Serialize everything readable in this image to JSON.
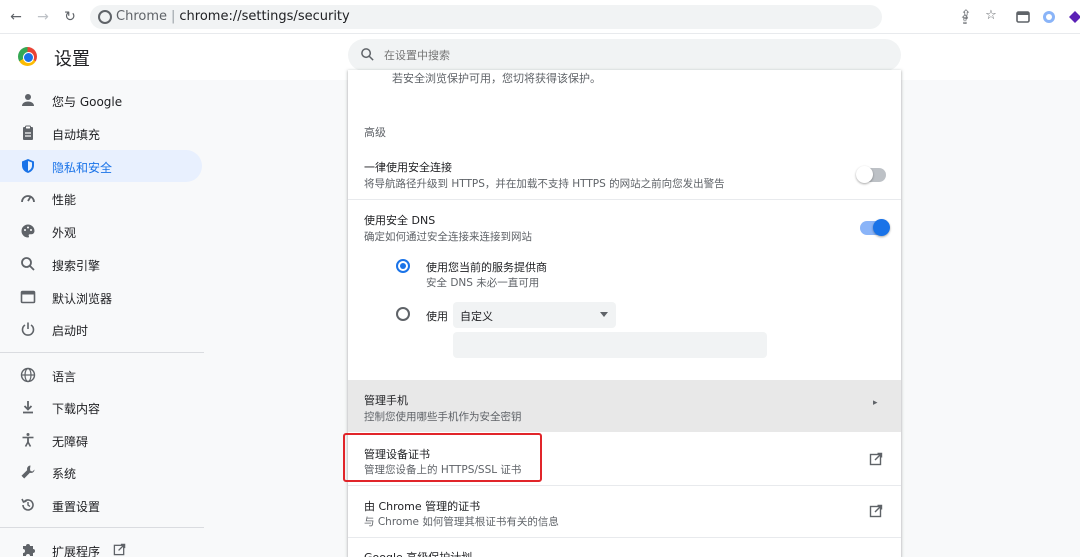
{
  "browser": {
    "omnibox_site": "Chrome",
    "omnibox_url": "chrome://settings/security",
    "icons": [
      "back-icon",
      "forward-icon",
      "reload-icon",
      "share-icon",
      "bookmark-star-icon",
      "extensions-icon",
      "profile-icon"
    ]
  },
  "header": {
    "title": "设置",
    "search_placeholder": "在设置中搜索"
  },
  "sidebar": {
    "items": [
      {
        "label": "您与 Google",
        "icon": "person-icon"
      },
      {
        "label": "自动填充",
        "icon": "clipboard-icon"
      },
      {
        "label": "隐私和安全",
        "icon": "shield-icon"
      },
      {
        "label": "性能",
        "icon": "gauge-icon"
      },
      {
        "label": "外观",
        "icon": "palette-icon"
      },
      {
        "label": "搜索引擎",
        "icon": "search-icon"
      },
      {
        "label": "默认浏览器",
        "icon": "browser-icon"
      },
      {
        "label": "启动时",
        "icon": "power-icon"
      },
      {
        "label": "语言",
        "icon": "globe-icon"
      },
      {
        "label": "下载内容",
        "icon": "download-icon"
      },
      {
        "label": "无障碍",
        "icon": "accessibility-icon"
      },
      {
        "label": "系统",
        "icon": "wrench-icon"
      },
      {
        "label": "重置设置",
        "icon": "reset-icon"
      },
      {
        "label": "扩展程序",
        "icon": "puzzle-icon"
      }
    ],
    "active_index": 2
  },
  "main": {
    "cut_text": "若安全浏览保护可用，您切将获得该保护。",
    "advanced_label": "高级",
    "https_title": "一律使用安全连接",
    "https_sub": "将导航路径升级到 HTTPS，并在加载不支持 HTTPS 的网站之前向您发出警告",
    "https_enabled": false,
    "dns_title": "使用安全 DNS",
    "dns_sub": "确定如何通过安全连接来连接到网站",
    "dns_enabled": true,
    "dns_option1_title": "使用您当前的服务提供商",
    "dns_option1_sub": "安全 DNS 未必一直可用",
    "dns_option2_label": "使用",
    "dns_option2_select": "自定义",
    "dns_custom_value": "",
    "phones_title": "管理手机",
    "phones_sub": "控制您使用哪些手机作为安全密钥",
    "certs_title": "管理设备证书",
    "certs_sub": "管理您设备上的 HTTPS/SSL 证书",
    "chrome_certs_title": "由 Chrome 管理的证书",
    "chrome_certs_sub": "与 Chrome 如何管理其根证书有关的信息",
    "advanced_protection_title": "Google 高级保护计划"
  },
  "colors": {
    "accent": "#1a73e8",
    "highlight": "#e1252a",
    "active_bg": "#e8f0fe"
  }
}
